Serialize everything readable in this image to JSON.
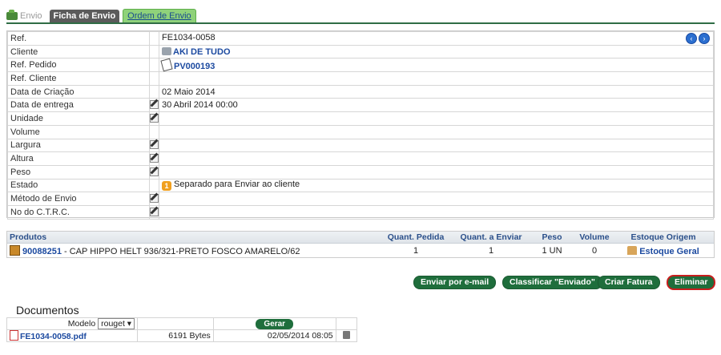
{
  "tabs": {
    "envio": "Envio",
    "ficha": "Ficha de Envio",
    "ordem": "Ordem de Envio"
  },
  "fields": {
    "ref": {
      "label": "Ref.",
      "value": "FE1034-0058"
    },
    "cliente": {
      "label": "Cliente",
      "value": "AKI DE TUDO"
    },
    "ref_pedido": {
      "label": "Ref. Pedido",
      "value": "PV000193"
    },
    "ref_cliente": {
      "label": "Ref. Cliente",
      "value": ""
    },
    "data_criacao": {
      "label": "Data de Criação",
      "value": "02 Maio 2014"
    },
    "data_entrega": {
      "label": "Data de entrega",
      "value": "30 Abril 2014 00:00"
    },
    "unidade": {
      "label": "Unidade",
      "value": ""
    },
    "volume": {
      "label": "Volume",
      "value": ""
    },
    "largura": {
      "label": "Largura",
      "value": ""
    },
    "altura": {
      "label": "Altura",
      "value": ""
    },
    "peso": {
      "label": "Peso",
      "value": ""
    },
    "estado": {
      "label": "Estado",
      "value": "Separado para Enviar ao cliente"
    },
    "metodo": {
      "label": "Método de Envio",
      "value": ""
    },
    "ctrc": {
      "label": "No do C.T.R.C.",
      "value": ""
    }
  },
  "products": {
    "headers": {
      "produtos": "Produtos",
      "quant_pedida": "Quant. Pedida",
      "quant_enviar": "Quant. a Enviar",
      "peso": "Peso",
      "volume": "Volume",
      "estoque": "Estoque Origem"
    },
    "row": {
      "code": "90088251",
      "description": " - CAP HIPPO HELT 936/321-PRETO FOSCO AMARELO/62",
      "quant_pedida": "1",
      "quant_enviar": "1",
      "peso": "1 UN",
      "volume": "0",
      "estoque": "Estoque Geral"
    }
  },
  "buttons": {
    "email": "Enviar por e-mail",
    "classificar": "Classificar \"Enviado\"",
    "fatura": "Criar Fatura",
    "eliminar": "Eliminar"
  },
  "documents": {
    "title": "Documentos",
    "modelo_label": "Modelo",
    "modelo_value": "rouget",
    "gerar": "Gerar",
    "file": {
      "name": "FE1034-0058.pdf",
      "size": "6191 Bytes",
      "date": "02/05/2014 08:05"
    }
  },
  "colors": {
    "accent": "#1f6e3c",
    "link": "#1c4aa0",
    "danger": "#c81e1e"
  }
}
